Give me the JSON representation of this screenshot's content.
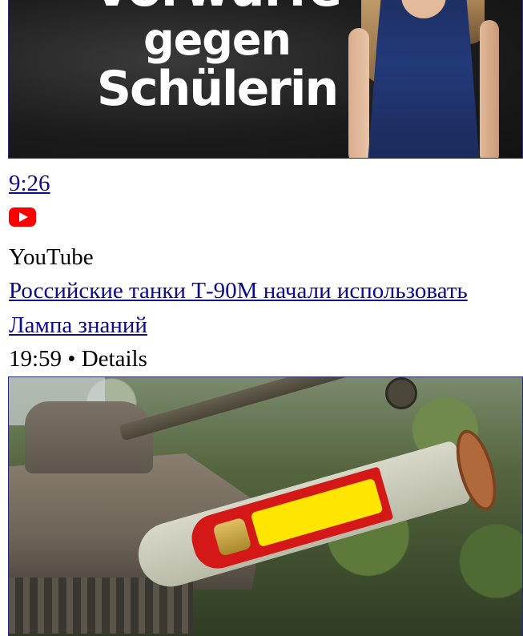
{
  "video_1": {
    "thumbnail_text": [
      "Vorwürfe",
      "gegen",
      "Schülerin"
    ],
    "duration": "9:26"
  },
  "source": {
    "icon": "youtube-icon",
    "label": "YouTube"
  },
  "video_2": {
    "title": "Российские танки Т-90М начали использовать",
    "channel": "Лампа знаний",
    "meta": "19:59 • Details"
  },
  "colors": {
    "link": "#0b0b8c",
    "youtube_red": "#ff0000"
  }
}
